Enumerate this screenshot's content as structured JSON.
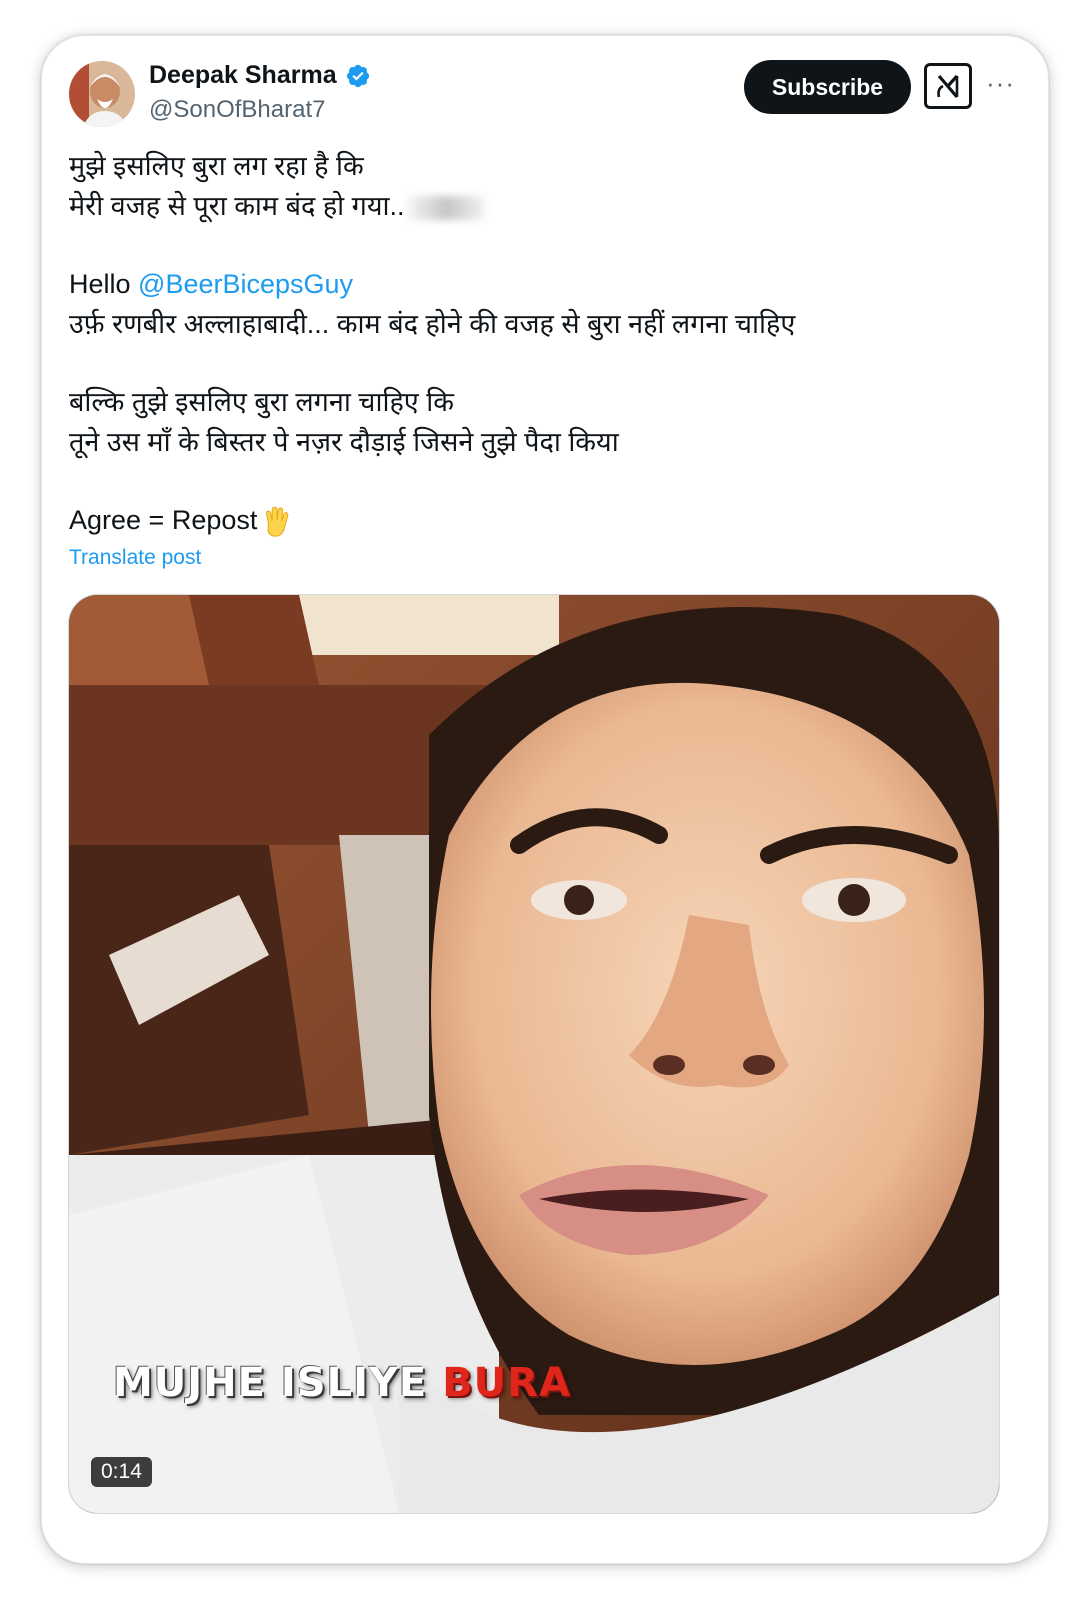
{
  "author": {
    "name": "Deepak Sharma",
    "handle": "@SonOfBharat7",
    "verified": true
  },
  "header": {
    "subscribe_label": "Subscribe",
    "grok_icon": "grok-icon",
    "more_icon": "more-options-icon",
    "more_label": "···"
  },
  "post": {
    "line1": "मुझे इसलिए बुरा लग रहा है कि",
    "line2": "मेरी वजह से पूरा काम बंद हो गया..",
    "line3_prefix": "Hello ",
    "mention": "@BeerBicepsGuy",
    "line4": "उर्फ़ रणबीर अल्लाहाबादी... काम बंद होने की वजह से बुरा नहीं लगना चाहिए",
    "line5": "बल्कि तुझे इसलिए बुरा लगना चाहिए कि",
    "line6": "तूने उस माँ के बिस्तर पे नज़र दौड़ाई जिसने तुझे पैदा किया",
    "line7": "Agree = Repost",
    "emoji": "raised-hand-emoji",
    "translate_label": "Translate post"
  },
  "media": {
    "caption_white": "MUJHE ISLIYE",
    "caption_red": "BURA",
    "duration": "0:14"
  },
  "colors": {
    "link": "#1d9bf0",
    "text": "#0f1419",
    "secondary": "#536471",
    "verified": "#1d9bf0"
  }
}
